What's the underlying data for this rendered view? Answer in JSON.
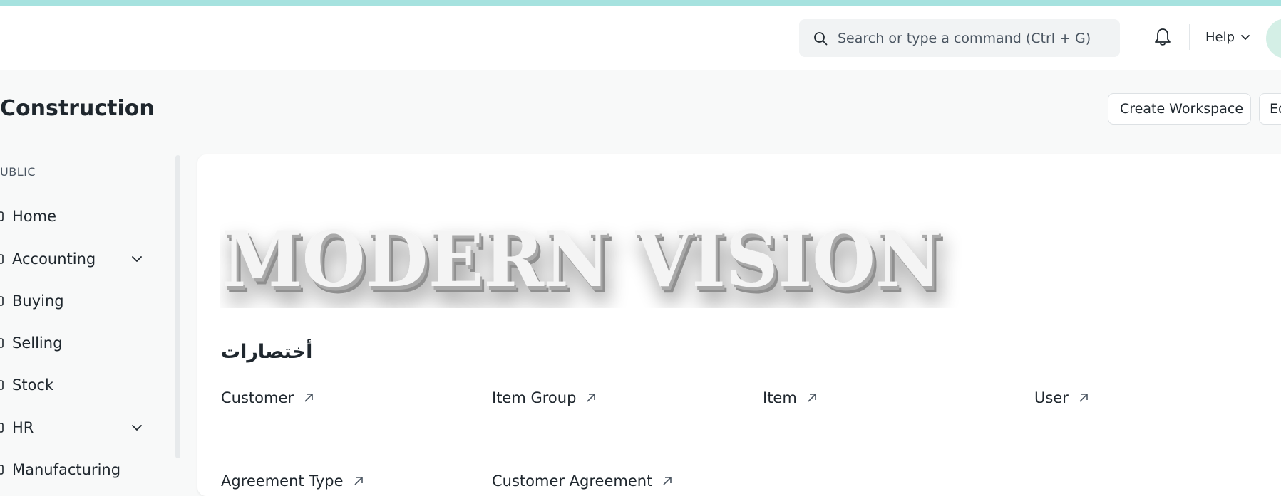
{
  "navbar": {
    "search_placeholder": "Search or type a command (Ctrl + G)",
    "help_label": "Help"
  },
  "page": {
    "title": "Construction",
    "create_workspace_label": "Create Workspace",
    "edit_label": "Ed"
  },
  "sidebar": {
    "section_label": "UBLIC",
    "items": [
      {
        "label": "Home",
        "expandable": false
      },
      {
        "label": "Accounting",
        "expandable": true
      },
      {
        "label": "Buying",
        "expandable": false
      },
      {
        "label": "Selling",
        "expandable": false
      },
      {
        "label": "Stock",
        "expandable": false
      },
      {
        "label": "HR",
        "expandable": true
      },
      {
        "label": "Manufacturing",
        "expandable": false
      }
    ]
  },
  "banner": {
    "text": "MODERN VISION"
  },
  "shortcuts": {
    "title": "أختصارات",
    "items": [
      {
        "label": "Customer"
      },
      {
        "label": "Item Group"
      },
      {
        "label": "Item"
      },
      {
        "label": "User"
      },
      {
        "label": "Agreement Type"
      },
      {
        "label": "Customer Agreement"
      }
    ]
  },
  "colors": {
    "accent_strip": "#a6e2df",
    "text_primary": "#1f272e",
    "page_background": "#f8f9f9"
  },
  "icons": {
    "search": "search-icon",
    "bell": "bell-icon",
    "chevron": "chevron-down-icon",
    "arrow": "arrow-up-right-icon"
  }
}
